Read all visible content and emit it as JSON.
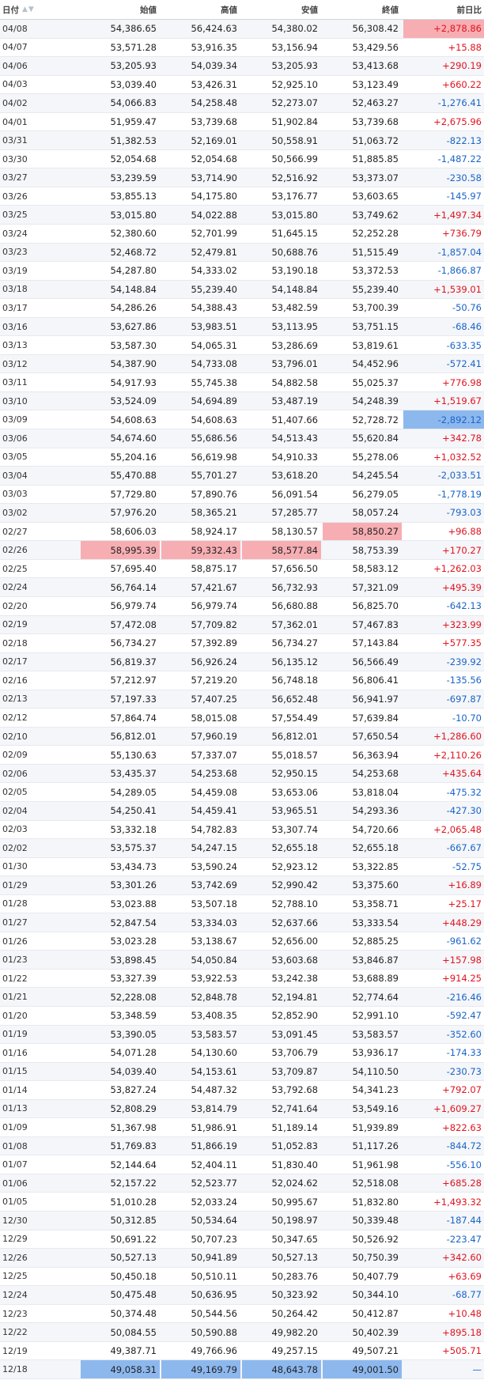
{
  "header": {
    "date": "日付",
    "open": "始値",
    "high": "高値",
    "low": "安値",
    "close": "終値",
    "change": "前日比",
    "sort_icons": "▲▼"
  },
  "colors": {
    "positive": "#e0131f",
    "negative": "#1a64c8",
    "highlight_high": "#f7aeb3",
    "highlight_low": "#8db8ee"
  },
  "rows": [
    [
      "04/08",
      "54,386.65",
      "56,424.63",
      "54,380.02",
      "56,308.42",
      "+2,878.86"
    ],
    [
      "04/07",
      "53,571.28",
      "53,916.35",
      "53,156.94",
      "53,429.56",
      "+15.88"
    ],
    [
      "04/06",
      "53,205.93",
      "54,039.34",
      "53,205.93",
      "53,413.68",
      "+290.19"
    ],
    [
      "04/03",
      "53,039.40",
      "53,426.31",
      "52,925.10",
      "53,123.49",
      "+660.22"
    ],
    [
      "04/02",
      "54,066.83",
      "54,258.48",
      "52,273.07",
      "52,463.27",
      "-1,276.41"
    ],
    [
      "04/01",
      "51,959.47",
      "53,739.68",
      "51,902.84",
      "53,739.68",
      "+2,675.96"
    ],
    [
      "03/31",
      "51,382.53",
      "52,169.01",
      "50,558.91",
      "51,063.72",
      "-822.13"
    ],
    [
      "03/30",
      "52,054.68",
      "52,054.68",
      "50,566.99",
      "51,885.85",
      "-1,487.22"
    ],
    [
      "03/27",
      "53,239.59",
      "53,714.90",
      "52,516.92",
      "53,373.07",
      "-230.58"
    ],
    [
      "03/26",
      "53,855.13",
      "54,175.80",
      "53,176.77",
      "53,603.65",
      "-145.97"
    ],
    [
      "03/25",
      "53,015.80",
      "54,022.88",
      "53,015.80",
      "53,749.62",
      "+1,497.34"
    ],
    [
      "03/24",
      "52,380.60",
      "52,701.99",
      "51,645.15",
      "52,252.28",
      "+736.79"
    ],
    [
      "03/23",
      "52,468.72",
      "52,479.81",
      "50,688.76",
      "51,515.49",
      "-1,857.04"
    ],
    [
      "03/19",
      "54,287.80",
      "54,333.02",
      "53,190.18",
      "53,372.53",
      "-1,866.87"
    ],
    [
      "03/18",
      "54,148.84",
      "55,239.40",
      "54,148.84",
      "55,239.40",
      "+1,539.01"
    ],
    [
      "03/17",
      "54,286.26",
      "54,388.43",
      "53,482.59",
      "53,700.39",
      "-50.76"
    ],
    [
      "03/16",
      "53,627.86",
      "53,983.51",
      "53,113.95",
      "53,751.15",
      "-68.46"
    ],
    [
      "03/13",
      "53,587.30",
      "54,065.31",
      "53,286.69",
      "53,819.61",
      "-633.35"
    ],
    [
      "03/12",
      "54,387.90",
      "54,733.08",
      "53,796.01",
      "54,452.96",
      "-572.41"
    ],
    [
      "03/11",
      "54,917.93",
      "55,745.38",
      "54,882.58",
      "55,025.37",
      "+776.98"
    ],
    [
      "03/10",
      "53,524.09",
      "54,694.89",
      "53,487.19",
      "54,248.39",
      "+1,519.67"
    ],
    [
      "03/09",
      "54,608.63",
      "54,608.63",
      "51,407.66",
      "52,728.72",
      "-2,892.12"
    ],
    [
      "03/06",
      "54,674.60",
      "55,686.56",
      "54,513.43",
      "55,620.84",
      "+342.78"
    ],
    [
      "03/05",
      "55,204.16",
      "56,619.98",
      "54,910.33",
      "55,278.06",
      "+1,032.52"
    ],
    [
      "03/04",
      "55,470.88",
      "55,701.27",
      "53,618.20",
      "54,245.54",
      "-2,033.51"
    ],
    [
      "03/03",
      "57,729.80",
      "57,890.76",
      "56,091.54",
      "56,279.05",
      "-1,778.19"
    ],
    [
      "03/02",
      "57,976.20",
      "58,365.21",
      "57,285.77",
      "58,057.24",
      "-793.03"
    ],
    [
      "02/27",
      "58,606.03",
      "58,924.17",
      "58,130.57",
      "58,850.27",
      "+96.88"
    ],
    [
      "02/26",
      "58,995.39",
      "59,332.43",
      "58,577.84",
      "58,753.39",
      "+170.27"
    ],
    [
      "02/25",
      "57,695.40",
      "58,875.17",
      "57,656.50",
      "58,583.12",
      "+1,262.03"
    ],
    [
      "02/24",
      "56,764.14",
      "57,421.67",
      "56,732.93",
      "57,321.09",
      "+495.39"
    ],
    [
      "02/20",
      "56,979.74",
      "56,979.74",
      "56,680.88",
      "56,825.70",
      "-642.13"
    ],
    [
      "02/19",
      "57,472.08",
      "57,709.82",
      "57,362.01",
      "57,467.83",
      "+323.99"
    ],
    [
      "02/18",
      "56,734.27",
      "57,392.89",
      "56,734.27",
      "57,143.84",
      "+577.35"
    ],
    [
      "02/17",
      "56,819.37",
      "56,926.24",
      "56,135.12",
      "56,566.49",
      "-239.92"
    ],
    [
      "02/16",
      "57,212.97",
      "57,219.20",
      "56,748.18",
      "56,806.41",
      "-135.56"
    ],
    [
      "02/13",
      "57,197.33",
      "57,407.25",
      "56,652.48",
      "56,941.97",
      "-697.87"
    ],
    [
      "02/12",
      "57,864.74",
      "58,015.08",
      "57,554.49",
      "57,639.84",
      "-10.70"
    ],
    [
      "02/10",
      "56,812.01",
      "57,960.19",
      "56,812.01",
      "57,650.54",
      "+1,286.60"
    ],
    [
      "02/09",
      "55,130.63",
      "57,337.07",
      "55,018.57",
      "56,363.94",
      "+2,110.26"
    ],
    [
      "02/06",
      "53,435.37",
      "54,253.68",
      "52,950.15",
      "54,253.68",
      "+435.64"
    ],
    [
      "02/05",
      "54,289.05",
      "54,459.08",
      "53,653.06",
      "53,818.04",
      "-475.32"
    ],
    [
      "02/04",
      "54,250.41",
      "54,459.41",
      "53,965.51",
      "54,293.36",
      "-427.30"
    ],
    [
      "02/03",
      "53,332.18",
      "54,782.83",
      "53,307.74",
      "54,720.66",
      "+2,065.48"
    ],
    [
      "02/02",
      "53,575.37",
      "54,247.15",
      "52,655.18",
      "52,655.18",
      "-667.67"
    ],
    [
      "01/30",
      "53,434.73",
      "53,590.24",
      "52,923.12",
      "53,322.85",
      "-52.75"
    ],
    [
      "01/29",
      "53,301.26",
      "53,742.69",
      "52,990.42",
      "53,375.60",
      "+16.89"
    ],
    [
      "01/28",
      "53,023.88",
      "53,507.18",
      "52,788.10",
      "53,358.71",
      "+25.17"
    ],
    [
      "01/27",
      "52,847.54",
      "53,334.03",
      "52,637.66",
      "53,333.54",
      "+448.29"
    ],
    [
      "01/26",
      "53,023.28",
      "53,138.67",
      "52,656.00",
      "52,885.25",
      "-961.62"
    ],
    [
      "01/23",
      "53,898.45",
      "54,050.84",
      "53,603.68",
      "53,846.87",
      "+157.98"
    ],
    [
      "01/22",
      "53,327.39",
      "53,922.53",
      "53,242.38",
      "53,688.89",
      "+914.25"
    ],
    [
      "01/21",
      "52,228.08",
      "52,848.78",
      "52,194.81",
      "52,774.64",
      "-216.46"
    ],
    [
      "01/20",
      "53,348.59",
      "53,408.35",
      "52,852.90",
      "52,991.10",
      "-592.47"
    ],
    [
      "01/19",
      "53,390.05",
      "53,583.57",
      "53,091.45",
      "53,583.57",
      "-352.60"
    ],
    [
      "01/16",
      "54,071.28",
      "54,130.60",
      "53,706.79",
      "53,936.17",
      "-174.33"
    ],
    [
      "01/15",
      "54,039.40",
      "54,153.61",
      "53,709.87",
      "54,110.50",
      "-230.73"
    ],
    [
      "01/14",
      "53,827.24",
      "54,487.32",
      "53,792.68",
      "54,341.23",
      "+792.07"
    ],
    [
      "01/13",
      "52,808.29",
      "53,814.79",
      "52,741.64",
      "53,549.16",
      "+1,609.27"
    ],
    [
      "01/09",
      "51,367.98",
      "51,986.91",
      "51,189.14",
      "51,939.89",
      "+822.63"
    ],
    [
      "01/08",
      "51,769.83",
      "51,866.19",
      "51,052.83",
      "51,117.26",
      "-844.72"
    ],
    [
      "01/07",
      "52,144.64",
      "52,404.11",
      "51,830.40",
      "51,961.98",
      "-556.10"
    ],
    [
      "01/06",
      "52,157.22",
      "52,523.77",
      "52,024.62",
      "52,518.08",
      "+685.28"
    ],
    [
      "01/05",
      "51,010.28",
      "52,033.24",
      "50,995.67",
      "51,832.80",
      "+1,493.32"
    ],
    [
      "12/30",
      "50,312.85",
      "50,534.64",
      "50,198.97",
      "50,339.48",
      "-187.44"
    ],
    [
      "12/29",
      "50,691.22",
      "50,707.23",
      "50,347.65",
      "50,526.92",
      "-223.47"
    ],
    [
      "12/26",
      "50,527.13",
      "50,941.89",
      "50,527.13",
      "50,750.39",
      "+342.60"
    ],
    [
      "12/25",
      "50,450.18",
      "50,510.11",
      "50,283.76",
      "50,407.79",
      "+63.69"
    ],
    [
      "12/24",
      "50,475.48",
      "50,636.95",
      "50,323.92",
      "50,344.10",
      "-68.77"
    ],
    [
      "12/23",
      "50,374.48",
      "50,544.56",
      "50,264.42",
      "50,412.87",
      "+10.48"
    ],
    [
      "12/22",
      "50,084.55",
      "50,590.88",
      "49,982.20",
      "50,402.39",
      "+895.18"
    ],
    [
      "12/19",
      "49,387.71",
      "49,766.96",
      "49,257.15",
      "49,507.21",
      "+505.71"
    ],
    [
      "12/18",
      "49,058.31",
      "49,169.79",
      "48,643.78",
      "49,001.50",
      "—"
    ]
  ],
  "highlights": [
    {
      "row": 0,
      "col": 5,
      "kind": "high"
    },
    {
      "row": 21,
      "col": 5,
      "kind": "low"
    },
    {
      "row": 27,
      "col": 4,
      "kind": "high"
    },
    {
      "row": 28,
      "col": 1,
      "kind": "high"
    },
    {
      "row": 28,
      "col": 2,
      "kind": "high"
    },
    {
      "row": 28,
      "col": 3,
      "kind": "high"
    },
    {
      "row": 72,
      "col": 1,
      "kind": "low"
    },
    {
      "row": 72,
      "col": 2,
      "kind": "low"
    },
    {
      "row": 72,
      "col": 3,
      "kind": "low"
    },
    {
      "row": 72,
      "col": 4,
      "kind": "low"
    }
  ]
}
